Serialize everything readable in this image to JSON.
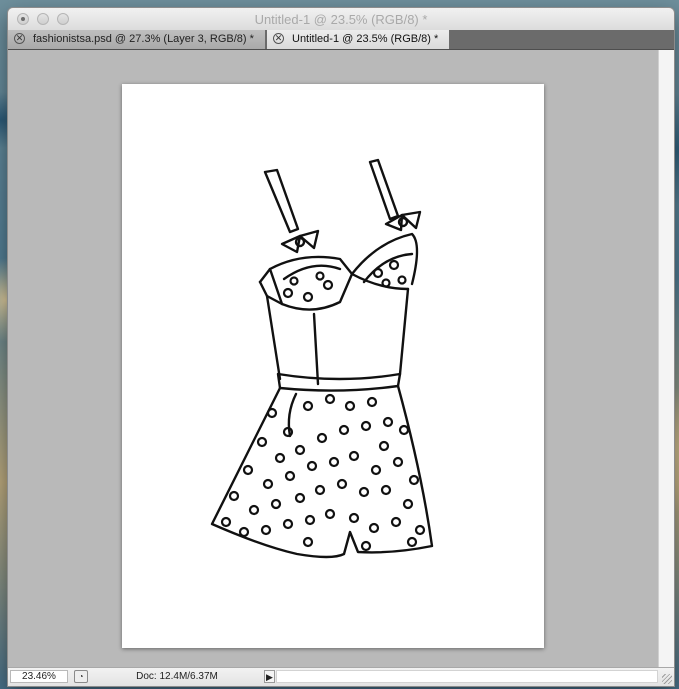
{
  "window": {
    "title": "Untitled-1 @ 23.5% (RGB/8) *"
  },
  "tabs": [
    {
      "label": "fashionistsa.psd @ 27.3% (Layer 3, RGB/8) *",
      "active": false
    },
    {
      "label": "Untitled-1 @ 23.5% (RGB/8) *",
      "active": true
    }
  ],
  "status": {
    "zoom": "23.46%",
    "doc_info": "Doc: 12.4M/6.37M",
    "arrow": "▶"
  },
  "colors": {
    "canvas_background": "#b9b9b9",
    "document": "#ffffff",
    "ink": "#111111"
  }
}
